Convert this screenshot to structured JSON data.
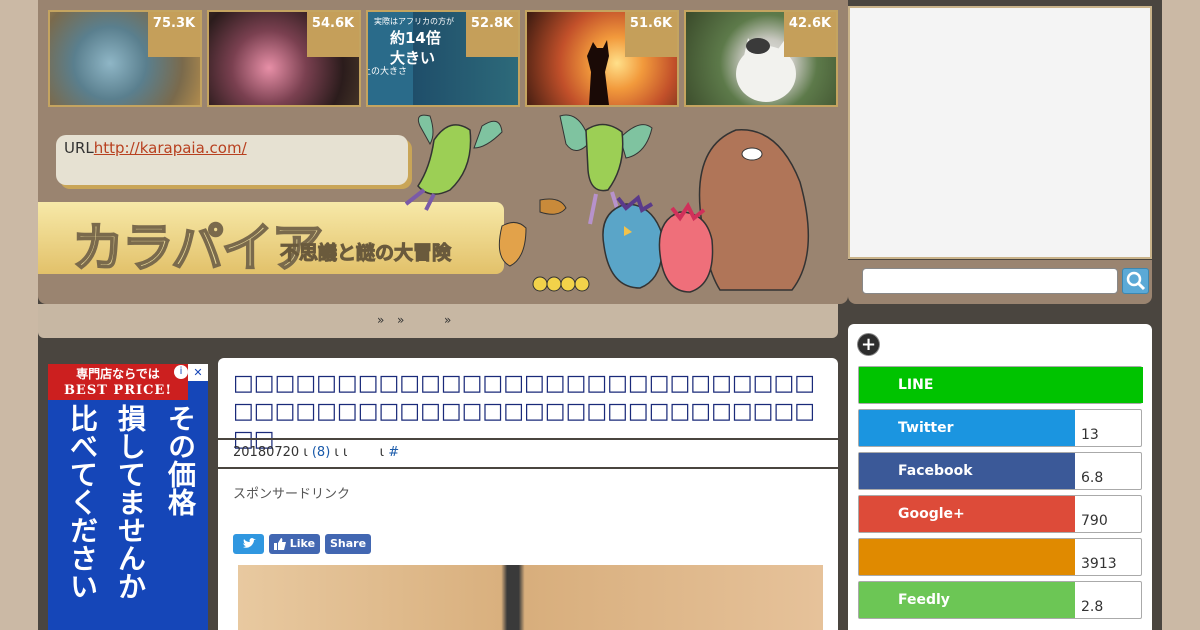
{
  "thumbnails": [
    {
      "count": "75.3K"
    },
    {
      "count": "54.6K"
    },
    {
      "count": "52.8K",
      "caption1": "実際はアフリカの方が",
      "caption2": "約14倍",
      "caption3": "大きい",
      "caption4": "上の大きさ"
    },
    {
      "count": "51.6K"
    },
    {
      "count": "42.6K"
    }
  ],
  "url_box": {
    "label": "URL",
    "link": "http://karapaia.com/"
  },
  "logo": {
    "title": "カラパイア",
    "tagline": "不思議と謎の大冒険"
  },
  "breadcrumb": {
    "sep1": "»",
    "sep2": "»",
    "sep3": "»"
  },
  "left_ad": {
    "line1": "専門店ならでは",
    "line2": "BEST PRICE!",
    "col1": "その価格",
    "col2": "損してませんか",
    "col3": "比べてください",
    "close": "✕",
    "info": "i"
  },
  "article": {
    "title": "□□□□□□□□□□□□□□□□□□□□□□□□□□□□□□□□□□□□□□□□□□□□□□□□□□□□□□□□□□",
    "date": "20180720",
    "sep1": "ι",
    "comments": "(8)",
    "sep2": "ι",
    "sep3": "ι",
    "sep4": "ι",
    "hash": "#",
    "sponsor": "スポンサードリンク",
    "share_like": "Like",
    "share_share": "Share"
  },
  "sidebar": {
    "items": [
      {
        "label": "LINE",
        "count": "",
        "color": "#00c300"
      },
      {
        "label": "Twitter",
        "count": "13",
        "color": "#1b95e0"
      },
      {
        "label": "Facebook",
        "count": "6.8",
        "color": "#3b5998"
      },
      {
        "label": "Google+",
        "count": "790",
        "color": "#dd4b39"
      },
      {
        "label": "",
        "count": "3913",
        "color": "#e08a00"
      },
      {
        "label": "Feedly",
        "count": "2.8",
        "color": "#6cc655"
      }
    ]
  }
}
